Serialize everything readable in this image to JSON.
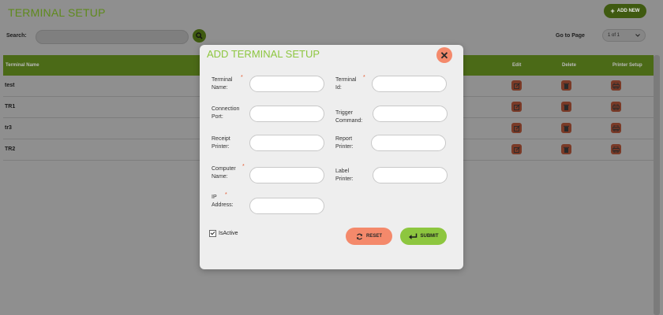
{
  "page": {
    "title": "TERMINAL SETUP",
    "add_new_label": "ADD NEW",
    "search_label": "Search:",
    "search_value": "",
    "goto_label": "Go to Page",
    "goto_value": "1 of 1"
  },
  "grid": {
    "columns": {
      "name": "Terminal Name",
      "edit": "Edit",
      "delete": "Delete",
      "printer": "Printer Setup"
    },
    "rows": [
      "test",
      "TR1",
      "tr3",
      "TR2"
    ]
  },
  "modal": {
    "title": "ADD TERMINAL SETUP",
    "fields": {
      "terminal_name": {
        "label1": "Terminal",
        "label2": "Name:",
        "value": ""
      },
      "terminal_id": {
        "label1": "Terminal",
        "label2": "Id:",
        "value": ""
      },
      "connection_port": {
        "label1": "Connection",
        "label2": "Port:",
        "value": ""
      },
      "trigger_command": {
        "label1": "Trigger",
        "label2": "Command:",
        "value": ""
      },
      "receipt_printer": {
        "label1": "Receipt",
        "label2": "Printer:",
        "value": ""
      },
      "report_printer": {
        "label1": "Report",
        "label2": "Printer:",
        "value": ""
      },
      "computer_name": {
        "label1": "Computer",
        "label2": "Name:",
        "value": ""
      },
      "label_printer": {
        "label1": "Label",
        "label2": "Printer:",
        "value": ""
      },
      "ip_address": {
        "label1": "IP",
        "label2": "Address:",
        "value": ""
      }
    },
    "required_mark": "*",
    "isactive_label": "IsActive",
    "isactive_checked": true,
    "reset_label": "RESET",
    "submit_label": "SUBMIT"
  },
  "colors": {
    "accent_green": "#8dc63f",
    "accent_salmon": "#f4896b"
  },
  "icons": {
    "add": "plus-icon",
    "search": "search-icon",
    "close": "close-icon",
    "edit": "edit-icon",
    "delete": "trash-icon",
    "printer": "printer-icon",
    "reset": "refresh-icon",
    "submit": "enter-arrow-icon"
  }
}
